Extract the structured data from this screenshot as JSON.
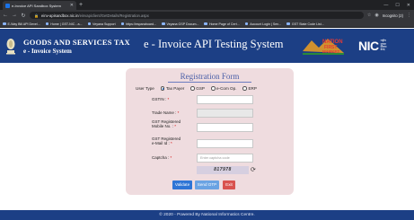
{
  "browser": {
    "tab_title": "e-Invoice API Sandbox System",
    "url_host": "einv-apisandbox.nic.in",
    "url_path": "/einvapiclient/GetDetails/Registration.aspx",
    "profile": "Incognito (2)",
    "bookmarks": [
      "E-Way Bill API Devel...",
      "Home | GST-NIC - a...",
      "Veyana Support",
      "https://esparaboard...",
      "Veyana GSP Docum...",
      "Home Page of Cert...",
      "Account Login | Sen...",
      "GST State Code List..."
    ]
  },
  "header": {
    "line1": "GOODS AND SERVICES TAX",
    "line2": "e - Invoice System",
    "title": "e - Invoice API Testing System",
    "nation_logo": {
      "line1": "NATION",
      "line2": "FIRST",
      "line3": "MARKET"
    },
    "nic_logo": {
      "text": "NIC",
      "sub1": "राष्ट्रीय",
      "sub2": "सूचना",
      "sub3": "विज्ञान",
      "sub4": "केन्द्र"
    }
  },
  "form": {
    "title": "Registration Form",
    "user_type_label": "User Type",
    "user_types": [
      "Tax Payer",
      "GSP",
      "e-Com Op.",
      "ERP"
    ],
    "selected_user_type": "Tax Payer",
    "gstin_label": "GSTIN :",
    "trade_name_label": "Trade Name :",
    "mobile_label_1": "GST Registered",
    "mobile_label_2": "Mobile No. :",
    "email_label_1": "GST Registered",
    "email_label_2": "e-Mail Id :",
    "captcha_label": "Captcha :",
    "captcha_placeholder": "Enter captcha code",
    "captcha_value": "817978",
    "required_mark": "*",
    "buttons": {
      "validate": "Validate",
      "send_otp": "Send OTP",
      "exit": "Exit"
    }
  },
  "footer": {
    "text": "© 2020 - Powered By National Informatics Centre."
  },
  "colors": {
    "header_bg": "#1c3f85",
    "form_bg": "#efdcdf",
    "title": "#4a5fa8"
  }
}
